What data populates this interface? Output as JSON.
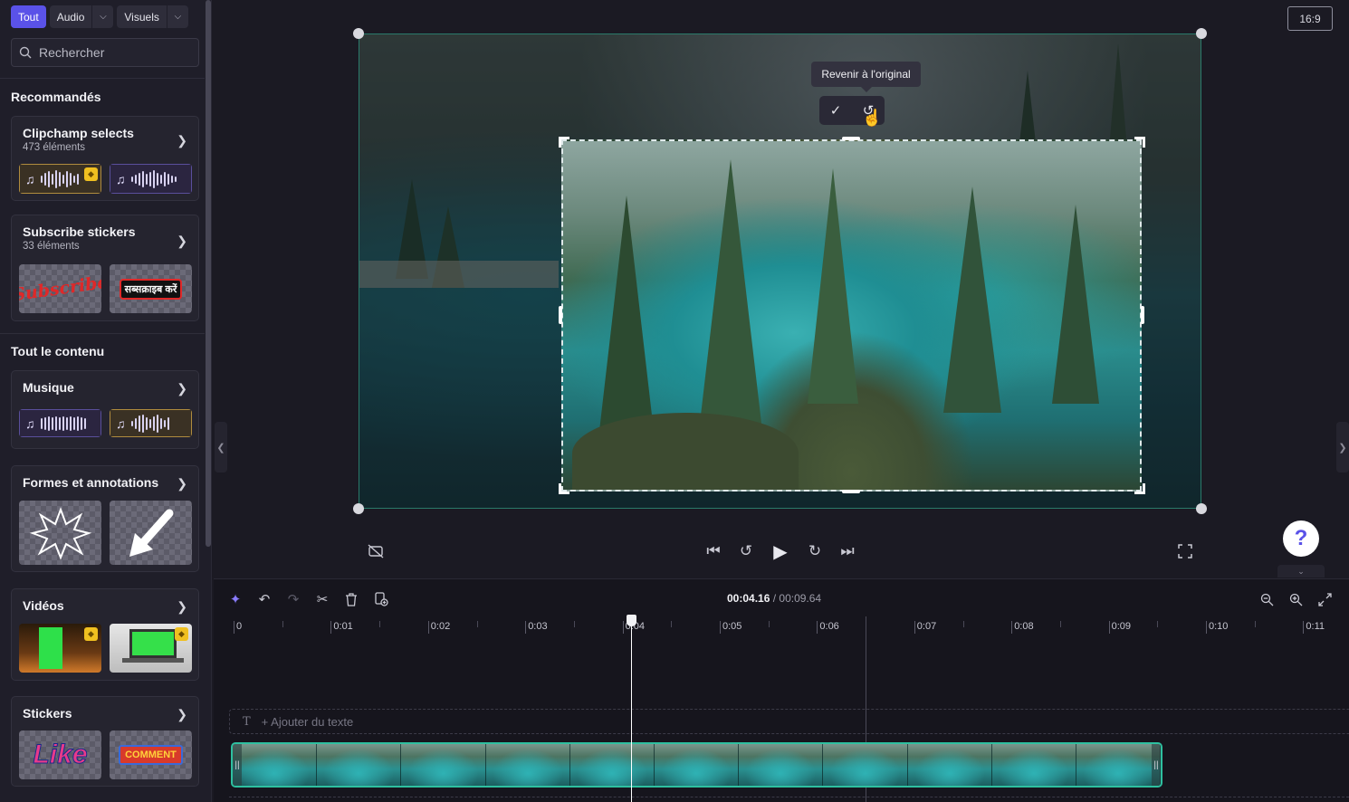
{
  "filters": {
    "all_label": "Tout",
    "audio_label": "Audio",
    "visuals_label": "Visuels"
  },
  "search": {
    "placeholder": "Rechercher"
  },
  "sidebar": {
    "recommended_title": "Recommandés",
    "all_content_title": "Tout le contenu",
    "cards": [
      {
        "title": "Clipchamp selects",
        "subtitle": "473 éléments"
      },
      {
        "title": "Subscribe stickers",
        "subtitle": "33 éléments"
      },
      {
        "title": "Musique"
      },
      {
        "title": "Formes et annotations"
      },
      {
        "title": "Vidéos"
      },
      {
        "title": "Stickers"
      }
    ],
    "sticker_texts": {
      "subscribe_en": "Subscribe",
      "subscribe_hi": "सब्सक्राइब करें",
      "like": "Like",
      "comment": "COMMENT"
    }
  },
  "preview": {
    "aspect_ratio": "16:9",
    "tooltip": "Revenir à l'original",
    "help_label": "?"
  },
  "timeline": {
    "current_time": "00:04.16",
    "separator": " / ",
    "total_time": "00:09.64",
    "add_text_placeholder": "+ Ajouter du texte",
    "ticks": [
      "0",
      "0:01",
      "0:02",
      "0:03",
      "0:04",
      "0:05",
      "0:06",
      "0:07",
      "0:08",
      "0:09",
      "0:10",
      "0:11"
    ]
  },
  "icons": {
    "accent": "#5a52e8",
    "clip_border": "#2ec0a0"
  }
}
